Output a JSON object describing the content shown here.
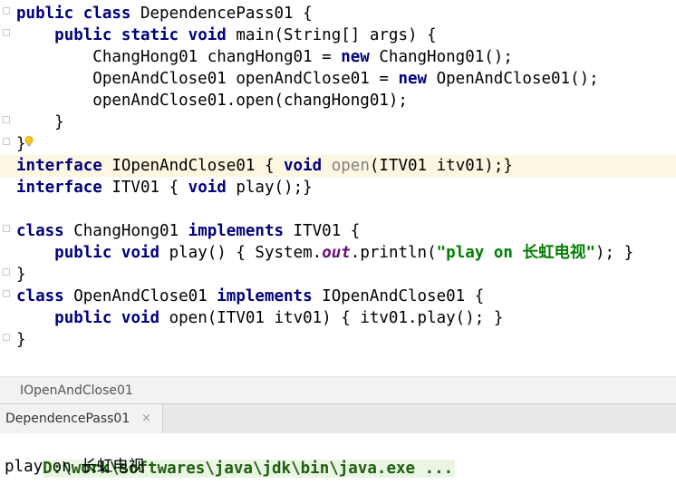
{
  "code": [
    {
      "line": 1,
      "current": false,
      "segments": [
        {
          "t": "public class",
          "c": "kw"
        },
        {
          "t": " DependencePass01 {",
          "c": ""
        }
      ]
    },
    {
      "line": 2,
      "current": false,
      "segments": [
        {
          "t": "    ",
          "c": ""
        },
        {
          "t": "public static void",
          "c": "kw"
        },
        {
          "t": " main(String[] args) {",
          "c": ""
        }
      ]
    },
    {
      "line": 3,
      "current": false,
      "segments": [
        {
          "t": "        ChangHong01 changHong01 = ",
          "c": ""
        },
        {
          "t": "new",
          "c": "kw"
        },
        {
          "t": " ChangHong01();",
          "c": ""
        }
      ]
    },
    {
      "line": 4,
      "current": false,
      "segments": [
        {
          "t": "        OpenAndClose01 openAndClose01 = ",
          "c": ""
        },
        {
          "t": "new",
          "c": "kw"
        },
        {
          "t": " OpenAndClose01();",
          "c": ""
        }
      ]
    },
    {
      "line": 5,
      "current": false,
      "segments": [
        {
          "t": "        openAndClose01.open(changHong01);",
          "c": ""
        }
      ]
    },
    {
      "line": 6,
      "current": false,
      "segments": [
        {
          "t": "    }",
          "c": ""
        }
      ]
    },
    {
      "line": 7,
      "current": false,
      "segments": [
        {
          "t": "}",
          "c": ""
        }
      ]
    },
    {
      "line": 8,
      "current": true,
      "segments": [
        {
          "t": "interface",
          "c": "kw"
        },
        {
          "t": " IOpenAndClose01 { ",
          "c": ""
        },
        {
          "t": "void",
          "c": "kw"
        },
        {
          "t": " ",
          "c": ""
        },
        {
          "t": "open",
          "c": "unused"
        },
        {
          "t": "(ITV01 itv01);}",
          "c": ""
        }
      ]
    },
    {
      "line": 9,
      "current": false,
      "segments": [
        {
          "t": "interface",
          "c": "kw"
        },
        {
          "t": " ITV01 { ",
          "c": ""
        },
        {
          "t": "void",
          "c": "kw"
        },
        {
          "t": " play();}",
          "c": ""
        }
      ]
    },
    {
      "line": 10,
      "current": false,
      "segments": [
        {
          "t": "",
          "c": ""
        }
      ]
    },
    {
      "line": 11,
      "current": false,
      "segments": [
        {
          "t": "class",
          "c": "kw"
        },
        {
          "t": " ChangHong01 ",
          "c": ""
        },
        {
          "t": "implements",
          "c": "kw"
        },
        {
          "t": " ITV01 {",
          "c": ""
        }
      ]
    },
    {
      "line": 12,
      "current": false,
      "segments": [
        {
          "t": "    ",
          "c": ""
        },
        {
          "t": "public void",
          "c": "kw"
        },
        {
          "t": " play() { System.",
          "c": ""
        },
        {
          "t": "out",
          "c": "fld"
        },
        {
          "t": ".println(",
          "c": ""
        },
        {
          "t": "\"play on 长虹电视\"",
          "c": "str"
        },
        {
          "t": "); }",
          "c": ""
        }
      ]
    },
    {
      "line": 13,
      "current": false,
      "segments": [
        {
          "t": "}",
          "c": ""
        }
      ]
    },
    {
      "line": 14,
      "current": false,
      "segments": [
        {
          "t": "class",
          "c": "kw"
        },
        {
          "t": " OpenAndClose01 ",
          "c": ""
        },
        {
          "t": "implements",
          "c": "kw"
        },
        {
          "t": " IOpenAndClose01 {",
          "c": ""
        }
      ]
    },
    {
      "line": 15,
      "current": false,
      "segments": [
        {
          "t": "    ",
          "c": ""
        },
        {
          "t": "public void",
          "c": "kw"
        },
        {
          "t": " open(ITV01 itv01) { itv01.play(); }",
          "c": ""
        }
      ]
    },
    {
      "line": 16,
      "current": false,
      "segments": [
        {
          "t": "}",
          "c": ""
        }
      ]
    }
  ],
  "breadcrumb": "IOpenAndClose01",
  "run_tab": {
    "label": "DependencePass01",
    "close_glyph": "×"
  },
  "console": {
    "command": "D:\\work\\softwares\\java\\jdk\\bin\\java.exe ...",
    "output": "play on 长虹电视"
  },
  "colors": {
    "keyword": "#000080",
    "string": "#008000",
    "field": "#660e7a",
    "current_line": "#fdf7e2",
    "command": "#1f5f0f"
  }
}
